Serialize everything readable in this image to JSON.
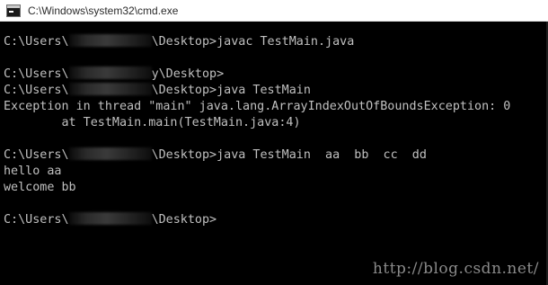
{
  "window": {
    "title": "C:\\Windows\\system32\\cmd.exe",
    "icon": "cmd-icon"
  },
  "console": {
    "lines": [
      {
        "pre": "C:\\Users\\",
        "redacted": true,
        "post": "\\Desktop>javac TestMain.java"
      },
      {
        "pre": "",
        "redacted": false,
        "post": ""
      },
      {
        "pre": "C:\\Users\\",
        "redacted": true,
        "post": "y\\Desktop>"
      },
      {
        "pre": "C:\\Users\\",
        "redacted": true,
        "post": "\\Desktop>java TestMain"
      },
      {
        "pre": "Exception in thread \"main\" java.lang.ArrayIndexOutOfBoundsException: 0",
        "redacted": false,
        "post": ""
      },
      {
        "pre": "        at TestMain.main(TestMain.java:4)",
        "redacted": false,
        "post": ""
      },
      {
        "pre": "",
        "redacted": false,
        "post": ""
      },
      {
        "pre": "C:\\Users\\",
        "redacted": true,
        "post": "\\Desktop>java TestMain  aa  bb  cc  dd"
      },
      {
        "pre": "hello aa",
        "redacted": false,
        "post": ""
      },
      {
        "pre": "welcome bb",
        "redacted": false,
        "post": ""
      },
      {
        "pre": "",
        "redacted": false,
        "post": ""
      },
      {
        "pre": "C:\\Users\\",
        "redacted": true,
        "post": "\\Desktop>"
      }
    ]
  },
  "watermark": "http://blog.csdn.net/"
}
